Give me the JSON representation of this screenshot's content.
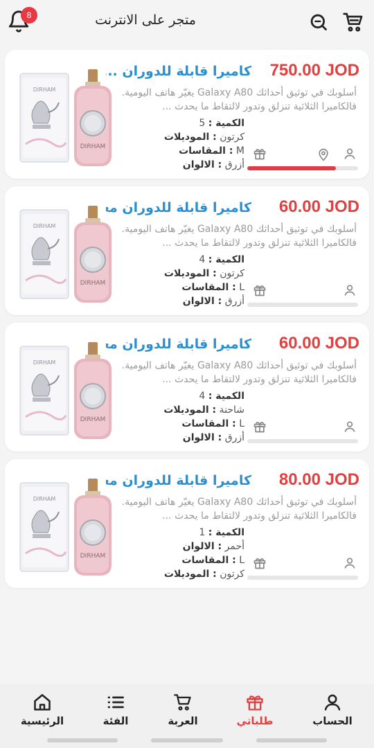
{
  "header": {
    "title": "متجر على الانترنت",
    "notification_count": "8"
  },
  "orders": [
    {
      "price": "750.00 JOD",
      "name": "كاميرا قابلة للدوران ...",
      "desc": "أسلوبك في توثيق أحداثك  Galaxy A80 يغيّر هاتف اليومية. فالكاميرا الثلاثية تنزلق وتدور لالتقاط ما يحدث ...",
      "attrs": [
        {
          "key": "الكمية",
          "value": "5",
          "keyFirst": true
        },
        {
          "key": "الموديلات",
          "value": "كرتون",
          "keyFirst": false
        },
        {
          "key": "المقاسات",
          "value": "M",
          "keyFirst": false
        },
        {
          "key": "الالوان",
          "value": "أزرق",
          "keyFirst": false
        }
      ],
      "progress": 0.8,
      "has_location": true
    },
    {
      "price": "60.00 JOD",
      "name": "كاميرا قابلة للدوران معدّ...",
      "desc": "أسلوبك في توثيق أحداثك  Galaxy A80 يغيّر هاتف اليومية. فالكاميرا الثلاثية تنزلق وتدور لالتقاط ما يحدث ...",
      "attrs": [
        {
          "key": "الكمية",
          "value": "4",
          "keyFirst": true
        },
        {
          "key": "الموديلات",
          "value": "كرتون",
          "keyFirst": false
        },
        {
          "key": "المقاسات",
          "value": "L",
          "keyFirst": false
        },
        {
          "key": "الالوان",
          "value": "أزرق",
          "keyFirst": false
        }
      ],
      "progress": 0,
      "has_location": false
    },
    {
      "price": "60.00 JOD",
      "name": "كاميرا قابلة للدوران معدّ...",
      "desc": "أسلوبك في توثيق أحداثك  Galaxy A80 يغيّر هاتف اليومية. فالكاميرا الثلاثية تنزلق وتدور لالتقاط ما يحدث ...",
      "attrs": [
        {
          "key": "الكمية",
          "value": "4",
          "keyFirst": true
        },
        {
          "key": "الموديلات",
          "value": "شاحنة",
          "keyFirst": false
        },
        {
          "key": "المقاسات",
          "value": "L",
          "keyFirst": false
        },
        {
          "key": "الالوان",
          "value": "أزرق",
          "keyFirst": false
        }
      ],
      "progress": 0,
      "has_location": false
    },
    {
      "price": "80.00 JOD",
      "name": "كاميرا قابلة للدوران معدّ...",
      "desc": "أسلوبك في توثيق أحداثك  Galaxy A80 يغيّر هاتف اليومية. فالكاميرا الثلاثية تنزلق وتدور لالتقاط ما يحدث ...",
      "attrs": [
        {
          "key": "الكمية",
          "value": "1",
          "keyFirst": true
        },
        {
          "key": "الالوان",
          "value": "أحمر",
          "keyFirst": false
        },
        {
          "key": "المقاسات",
          "value": "L",
          "keyFirst": false
        },
        {
          "key": "الموديلات",
          "value": "كرتون",
          "keyFirst": false
        }
      ],
      "progress": 0,
      "has_location": false
    }
  ],
  "nav": {
    "account": "الحساب",
    "orders": "طلباتي",
    "cart": "العربة",
    "category": "الفئة",
    "home": "الرئيسية"
  },
  "colors": {
    "accent": "#e63946",
    "price": "#e04040",
    "link": "#2a8fcf"
  },
  "icons": [
    "bell-icon",
    "search-icon",
    "cart-icon",
    "gift-icon",
    "location-pin-icon",
    "user-icon",
    "list-icon",
    "home-icon"
  ]
}
